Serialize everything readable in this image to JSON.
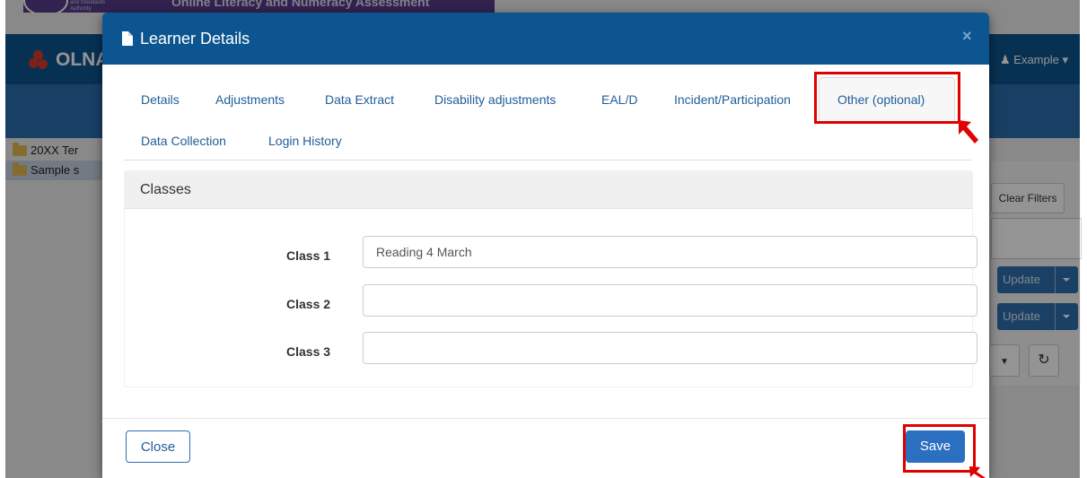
{
  "background": {
    "banner": {
      "authority_text": "and Standards Authority",
      "title": "Online Literacy and Numeracy Assessment"
    },
    "brand": "OLNA",
    "user_menu": "Example",
    "tree": [
      "20XX Ter",
      "Sample s"
    ],
    "clear_filters": "Clear Filters",
    "update_label": "Update",
    "refresh_glyph": "↻"
  },
  "modal": {
    "title": "Learner Details",
    "close_glyph": "×",
    "tabs_row1": [
      "Details",
      "Adjustments",
      "Data Extract",
      "Disability adjustments",
      "EAL/D",
      "Incident/Participation",
      "Other (optional)"
    ],
    "tabs_row2": [
      "Data Collection",
      "Login History"
    ],
    "active_tab": "Other (optional)",
    "panel_title": "Classes",
    "fields": [
      {
        "label": "Class 1",
        "value": "Reading 4 March"
      },
      {
        "label": "Class 2",
        "value": ""
      },
      {
        "label": "Class 3",
        "value": ""
      }
    ],
    "close_button": "Close",
    "save_button": "Save"
  },
  "colors": {
    "header_blue": "#0d5590",
    "link_blue": "#1f5d98",
    "save_blue": "#2a6fc0",
    "highlight_red": "#e00000"
  },
  "icons": [
    "document-icon",
    "close-icon",
    "folder-icon",
    "user-icon",
    "caret-down-icon",
    "refresh-icon",
    "arrow-pointer-icon"
  ]
}
